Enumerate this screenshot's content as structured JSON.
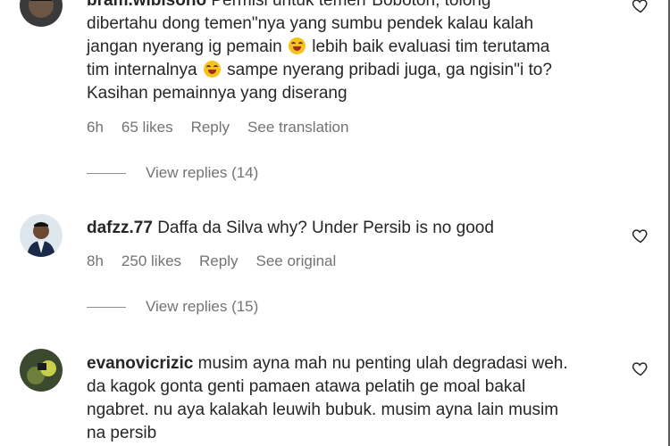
{
  "comments": [
    {
      "username": "bram.wibisono",
      "lines": [
        "Permisi untuk temen\"Bobotoh, tolong",
        "dibertahu dong temen\"nya yang sumbu pendek kalau kalah",
        "jangan nyerang ig pemain",
        "lebih baik evaluasi tim terutama",
        "tim internalnya",
        "sampe nyerang pribadi juga, ga ngisin\"i to?",
        "Kasihan pemainnya yang diserang"
      ],
      "time": "6h",
      "likes": "65 likes",
      "reply": "Reply",
      "action": "See translation",
      "view_replies": "View replies (14)"
    },
    {
      "username": "dafzz.77",
      "text": "Daffa da Silva why? Under Persib is no good",
      "time": "8h",
      "likes": "250 likes",
      "reply": "Reply",
      "action": "See original",
      "view_replies": "View replies (15)"
    },
    {
      "username": "evanovicrizic",
      "lines": [
        "musim ayna mah nu penting ulah degradasi weh.",
        "da kagok gonta genti pamaen atawa pelatih ge moal bakal",
        "ngabret. nu aya kalakah leuwih bubuk. musim ayna lain musim",
        "na persib"
      ]
    }
  ],
  "icons": {
    "heart": "heart-icon",
    "emoji": "laughing-emoji-icon"
  },
  "colors": {
    "text": "#262626",
    "muted": "#737373"
  }
}
